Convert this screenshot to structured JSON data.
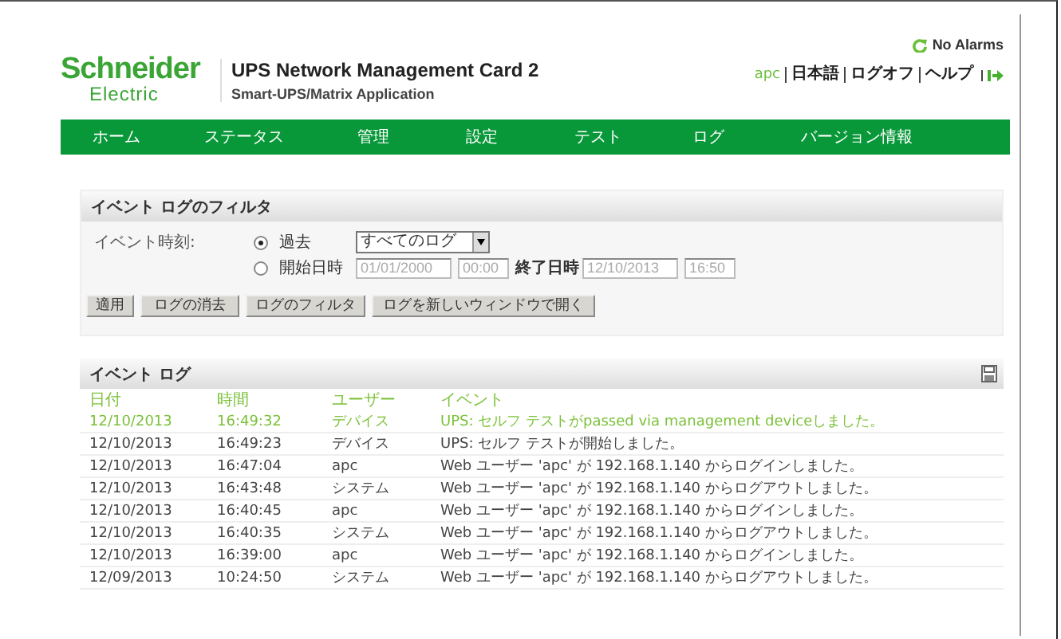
{
  "header": {
    "logo_top": "Schneider",
    "logo_bottom": "Electric",
    "title": "UPS Network Management Card 2",
    "subtitle": "Smart-UPS/Matrix Application",
    "alarm_status": "No Alarms",
    "user": "apc",
    "links": [
      "日本語",
      "ログオフ",
      "ヘルプ"
    ]
  },
  "nav": [
    "ホーム",
    "ステータス",
    "管理",
    "設定",
    "テスト",
    "ログ",
    "バージョン情報"
  ],
  "filter": {
    "title": "イベント ログのフィルタ",
    "label": "イベント時刻:",
    "options": [
      {
        "label": "過去",
        "selected": true
      },
      {
        "label": "開始日時",
        "selected": false
      }
    ],
    "range_select": "すべてのログ",
    "start_date": "01/01/2000",
    "start_time": "00:00",
    "end_label": "終了日時",
    "end_date": "12/10/2013",
    "end_time": "16:50",
    "buttons": [
      "適用",
      "ログの消去",
      "ログのフィルタ",
      "ログを新しいウィンドウで開く"
    ]
  },
  "log": {
    "title": "イベント ログ",
    "columns": [
      "日付",
      "時間",
      "ユーザー",
      "イベント"
    ],
    "rows": [
      {
        "date": "12/10/2013",
        "time": "16:49:32",
        "user": "デバイス",
        "event": "UPS: セルフ テストがpassed via management deviceしました。",
        "highlighted": true
      },
      {
        "date": "12/10/2013",
        "time": "16:49:23",
        "user": "デバイス",
        "event": "UPS: セルフ テストが開始しました。",
        "highlighted": false
      },
      {
        "date": "12/10/2013",
        "time": "16:47:04",
        "user": "apc",
        "event": "Web ユーザー 'apc' が 192.168.1.140 からログインしました。",
        "highlighted": false
      },
      {
        "date": "12/10/2013",
        "time": "16:43:48",
        "user": "システム",
        "event": "Web ユーザー 'apc' が 192.168.1.140 からログアウトしました。",
        "highlighted": false
      },
      {
        "date": "12/10/2013",
        "time": "16:40:45",
        "user": "apc",
        "event": "Web ユーザー 'apc' が 192.168.1.140 からログインしました。",
        "highlighted": false
      },
      {
        "date": "12/10/2013",
        "time": "16:40:35",
        "user": "システム",
        "event": "Web ユーザー 'apc' が 192.168.1.140 からログアウトしました。",
        "highlighted": false
      },
      {
        "date": "12/10/2013",
        "time": "16:39:00",
        "user": "apc",
        "event": "Web ユーザー 'apc' が 192.168.1.140 からログインしました。",
        "highlighted": false
      },
      {
        "date": "12/09/2013",
        "time": "10:24:50",
        "user": "システム",
        "event": "Web ユーザー 'apc' が 192.168.1.140 からログアウトしました。",
        "highlighted": false
      }
    ]
  }
}
